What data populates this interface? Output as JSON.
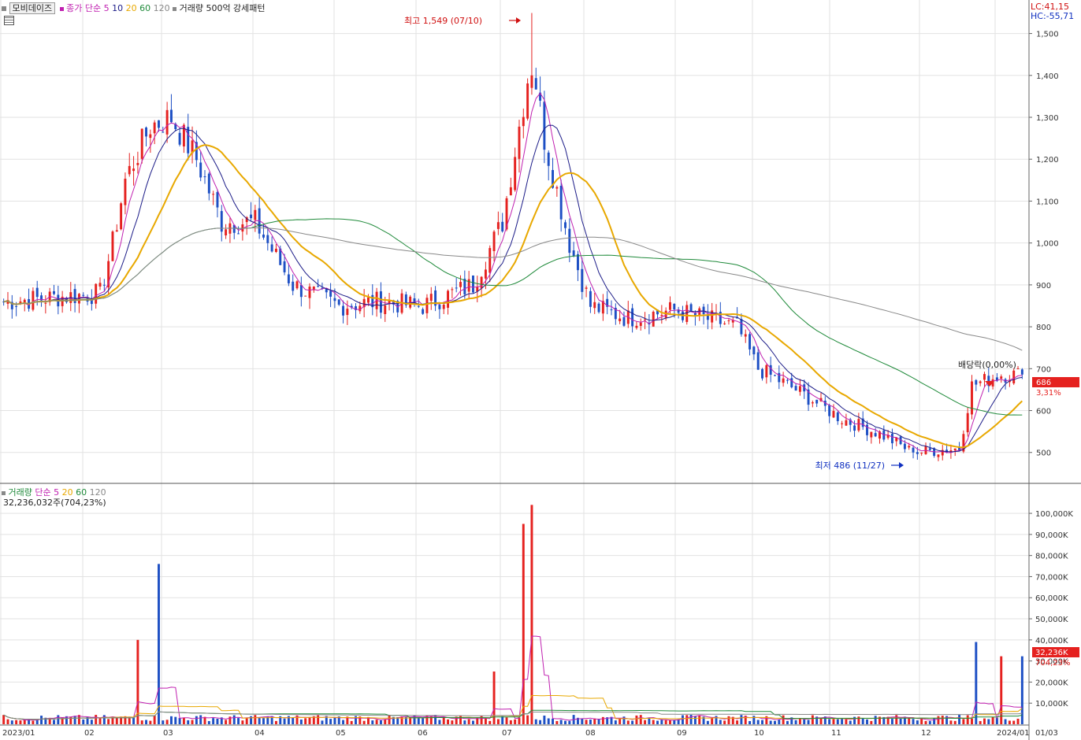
{
  "header": {
    "stock_name": "모비데이즈",
    "price_ma_label": "종가 단순",
    "price_ma_periods": [
      "5",
      "10",
      "20",
      "60",
      "120"
    ],
    "volume_ma_labels": [
      "거래량 500억 강세패턴"
    ],
    "lc_label": "LC:41,15",
    "hc_label": "HC:-55,71"
  },
  "volume_header": {
    "title": "거래량",
    "ma_label": "단순",
    "ma_periods": [
      "5",
      "20",
      "60",
      "120"
    ],
    "current_value": "32,236,032주(704,23%)"
  },
  "annotations": {
    "high": "최고 1,549 (07/10)",
    "low": "최저 486 (11/27)",
    "dividend": "배당락(0,00%)"
  },
  "price_tag": {
    "value": "686",
    "change": "3,31%"
  },
  "volume_tag": {
    "value": "32,236K",
    "change": "704,23%"
  },
  "colors": {
    "up": "#e5211f",
    "down": "#1d4fc4",
    "ma5": "#c020b0",
    "ma10": "#1c1c88",
    "ma20": "#e8a800",
    "ma60": "#1f8a3a",
    "ma120": "#888888"
  },
  "chart_data": [
    {
      "type": "candlestick",
      "y_axis_ticks": [
        "1,500",
        "1,400",
        "1,300",
        "1,200",
        "1,100",
        "1,000",
        "900",
        "800",
        "700",
        "600",
        "500"
      ],
      "ylim": [
        430,
        1580
      ],
      "x_ticks": [
        "2023/01",
        "02",
        "03",
        "04",
        "05",
        "06",
        "07",
        "08",
        "09",
        "10",
        "11",
        "12",
        "2024/01",
        "01/03"
      ],
      "series": [
        {
          "name": "5",
          "type": "line"
        },
        {
          "name": "10",
          "type": "line"
        },
        {
          "name": "20",
          "type": "line"
        },
        {
          "name": "60",
          "type": "line"
        },
        {
          "name": "120",
          "type": "line"
        }
      ],
      "anchors": [
        {
          "date": "2023-01",
          "close": 860
        },
        {
          "date": "2023-01-20",
          "close": 870
        },
        {
          "date": "2023-02-05",
          "close": 880
        },
        {
          "date": "2023-02-10",
          "close": 1000
        },
        {
          "date": "2023-02-15",
          "close": 1150
        },
        {
          "date": "2023-02-25",
          "close": 1280
        },
        {
          "date": "2023-03-01",
          "close": 1300
        },
        {
          "date": "2023-03-10",
          "close": 1200
        },
        {
          "date": "2023-03-20",
          "close": 1050
        },
        {
          "date": "2023-04-01",
          "close": 1050
        },
        {
          "date": "2023-04-15",
          "close": 900
        },
        {
          "date": "2023-05-01",
          "close": 850
        },
        {
          "date": "2023-05-15",
          "close": 860
        },
        {
          "date": "2023-06-01",
          "close": 850
        },
        {
          "date": "2023-06-20",
          "close": 900
        },
        {
          "date": "2023-06-30",
          "close": 1050
        },
        {
          "date": "2023-07-10",
          "close": 1450
        },
        {
          "date": "2023-07-15",
          "close": 1250
        },
        {
          "date": "2023-07-25",
          "close": 1000
        },
        {
          "date": "2023-08-01",
          "close": 850
        },
        {
          "date": "2023-08-15",
          "close": 820
        },
        {
          "date": "2023-09-01",
          "close": 840
        },
        {
          "date": "2023-09-25",
          "close": 800
        },
        {
          "date": "2023-10-01",
          "close": 700
        },
        {
          "date": "2023-10-15",
          "close": 650
        },
        {
          "date": "2023-11-01",
          "close": 580
        },
        {
          "date": "2023-11-15",
          "close": 545
        },
        {
          "date": "2023-11-27",
          "close": 500
        },
        {
          "date": "2023-12-15",
          "close": 510
        },
        {
          "date": "2023-12-20",
          "close": 660
        },
        {
          "date": "2024-01-03",
          "close": 686
        }
      ],
      "high": {
        "value": 1549,
        "date": "07/10"
      },
      "low": {
        "value": 486,
        "date": "11/27"
      },
      "last_close": 686
    },
    {
      "type": "bar",
      "title": "거래량",
      "y_axis_ticks": [
        "100,000K",
        "90,000K",
        "80,000K",
        "70,000K",
        "60,000K",
        "50,000K",
        "40,000K",
        "30,000K",
        "20,000K",
        "10,000K"
      ],
      "ylim": [
        0,
        106000
      ],
      "unit": "K",
      "spikes": [
        {
          "date": "2023-02-20",
          "value": 40000
        },
        {
          "date": "2023-02-28",
          "value": 76000
        },
        {
          "date": "2023-06-28",
          "value": 25000
        },
        {
          "date": "2023-07-07",
          "value": 95000
        },
        {
          "date": "2023-07-10",
          "value": 104000
        },
        {
          "date": "2023-12-21",
          "value": 39000
        },
        {
          "date": "2024-01-03",
          "value": 32236
        }
      ],
      "last_value": 32236
    }
  ]
}
